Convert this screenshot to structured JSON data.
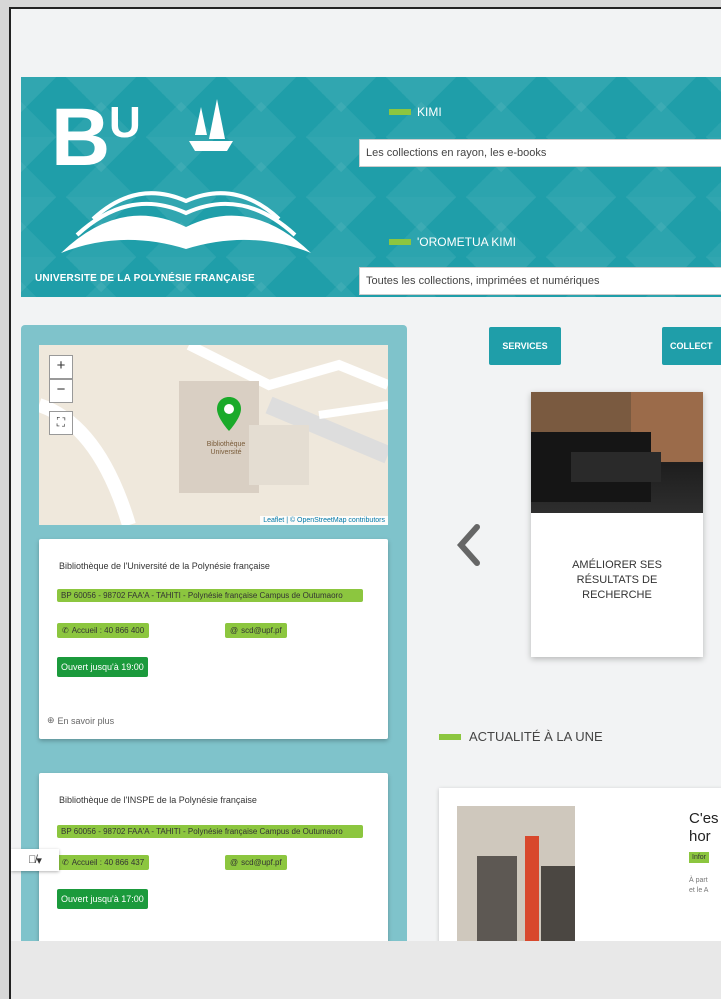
{
  "colors": {
    "teal": "#1f9ea9",
    "green": "#8cc63f",
    "open_green": "#1b9a3c",
    "sidebar": "#7fc3cb"
  },
  "logo": {
    "letters": "BU",
    "caption": "UNIVERSITE DE LA POLYNÉSIE FRANÇAISE"
  },
  "search": [
    {
      "label": "KIMI",
      "placeholder": "Les collections en rayon, les e-books"
    },
    {
      "label": "'OROMETUA KIMI",
      "placeholder": "Toutes les collections, imprimées et numériques"
    }
  ],
  "map": {
    "zoom_in": "+",
    "zoom_out": "−",
    "fullscreen": "⛶",
    "marker_label": "Bibliothèque Université",
    "attribution": "Leaflet | © OpenStreetMap contributors"
  },
  "libraries": [
    {
      "name": "Bibliothèque de l'Université de la Polynésie française",
      "address": "BP 60056 - 98702 FAA'A - TAHITI - Polynésie française Campus de Outumaoro",
      "phone": "Accueil : 40 866 400",
      "email": "scd@upf.pf",
      "status": "Ouvert jusqu'à 19:00",
      "more": "En savoir plus"
    },
    {
      "name": "Bibliothèque de l'INSPE de la Polynésie française",
      "address": "BP 60056 - 98702 FAA'A - TAHITI - Polynésie française Campus de Outumaoro",
      "phone": "Accueil : 40 866 437",
      "email": "scd@upf.pf",
      "status": "Ouvert jusqu'à 17:00"
    }
  ],
  "nav": {
    "services": "SERVICES",
    "collections": "COLLECT"
  },
  "carousel": {
    "prev": "‹",
    "tile_caption": "AMÉLIORER SES RÉSULTATS DE RECHERCHE"
  },
  "news": {
    "section_title": "ACTUALITÉ À LA UNE",
    "title_line1": "C'es",
    "title_line2": "hor",
    "tag": "Infor",
    "excerpt_line1": "À part",
    "excerpt_line2": "et le A"
  },
  "accessibility": {
    "icon": "eye-slash-icon",
    "caret": "▾"
  }
}
